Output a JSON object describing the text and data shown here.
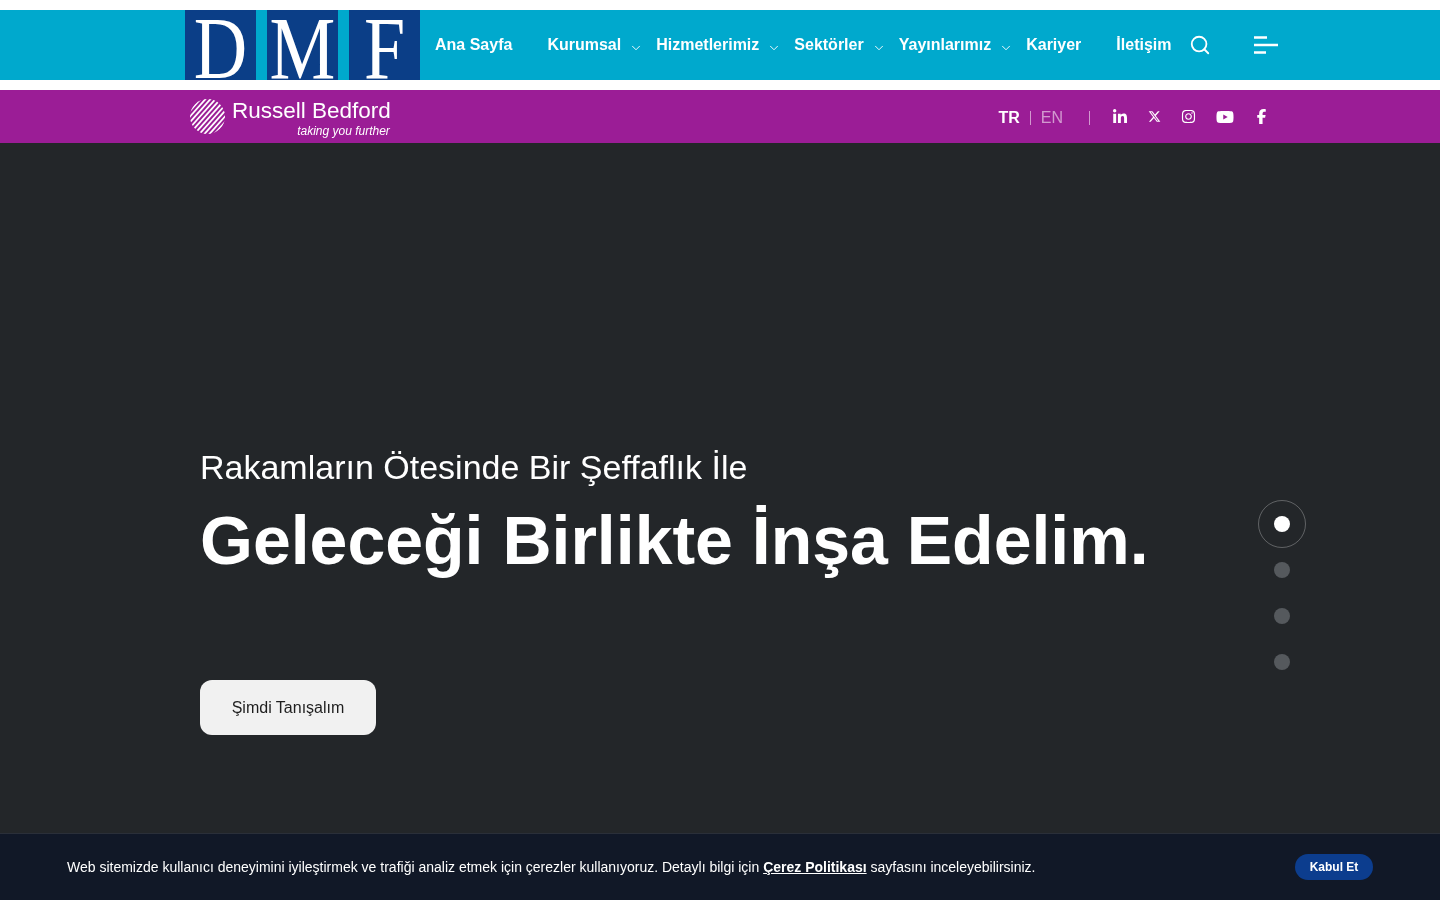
{
  "header": {
    "logo": {
      "letters": [
        "D",
        "M",
        "F"
      ]
    },
    "nav": [
      {
        "label": "Ana Sayfa",
        "has_submenu": false
      },
      {
        "label": "Kurumsal",
        "has_submenu": true
      },
      {
        "label": "Hizmetlerimiz",
        "has_submenu": true
      },
      {
        "label": "Sektörler",
        "has_submenu": true
      },
      {
        "label": "Yayınlarımız",
        "has_submenu": true
      },
      {
        "label": "Kariyer",
        "has_submenu": false
      },
      {
        "label": "İletişim",
        "has_submenu": false
      }
    ]
  },
  "brand_bar": {
    "brand": {
      "name": "Russell Bedford",
      "tagline": "taking you further"
    },
    "languages": [
      {
        "label": "TR",
        "selected": true
      },
      {
        "label": "EN",
        "selected": false
      }
    ]
  },
  "hero": {
    "subtitle": "Rakamların Ötesinde Bir Şeffaflık İle",
    "title": "Geleceği Birlikte İnşa Edelim.",
    "button": "Şimdi Tanışalım",
    "slides": [
      {
        "selected": true
      },
      {
        "selected": false
      },
      {
        "selected": false
      },
      {
        "selected": false
      }
    ]
  },
  "cookie_banner": {
    "text_before": "Web sitemizde kullanıcı deneyimini iyileştirmek ve trafiği analiz etmek için çerezler kullanıyoruz. Detaylı bilgi için",
    "link": "Çerez Politikası",
    "text_after": "sayfasını inceleyebilirsiniz.",
    "button": "Kabul Et"
  }
}
